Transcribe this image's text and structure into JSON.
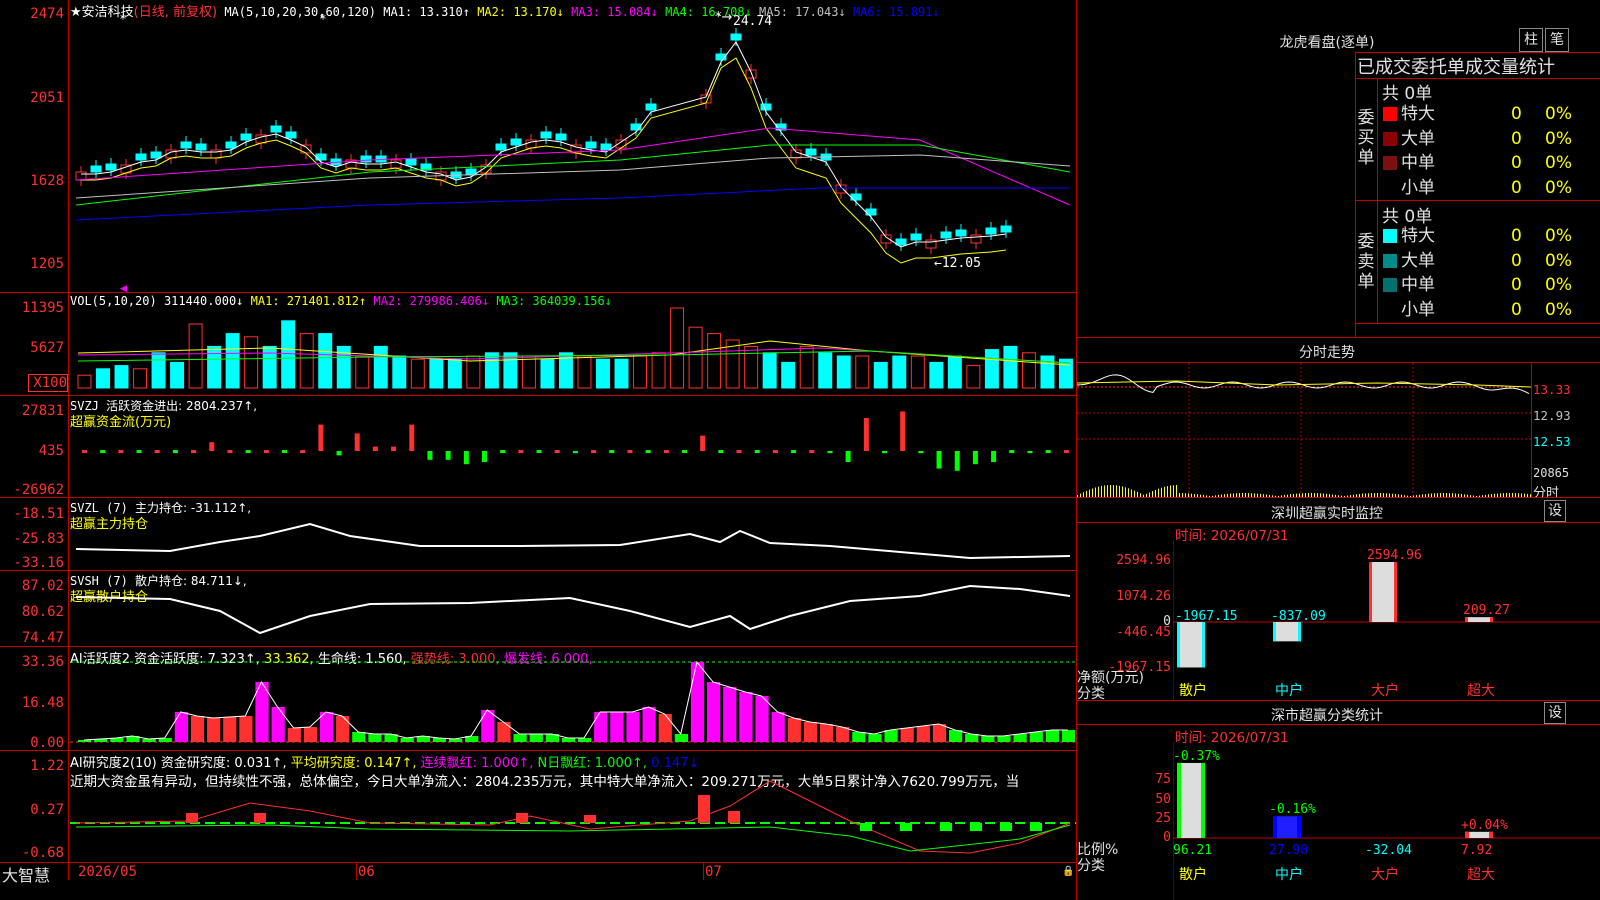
{
  "stock": {
    "name": "★安洁科技",
    "mode": "(日线, 前复权)",
    "ma_label": "MA(5,10,20,30,60,120)",
    "ma_values": [
      {
        "label": "MA1: 13.310↑",
        "color": "#ffffff"
      },
      {
        "label": "MA2: 13.170↓",
        "color": "#ffff00"
      },
      {
        "label": "MA3: 15.084↓",
        "color": "#ff00ff"
      },
      {
        "label": "MA4: 16.708↓",
        "color": "#00ff00"
      },
      {
        "label": "MA5: 17.043↓",
        "color": "#c0c0c0"
      },
      {
        "label": "MA6: 15.891↓",
        "color": "#0000ff"
      }
    ],
    "high_marker": "24.74",
    "low_marker": "←12.05",
    "price_ticks": [
      "2474",
      "2051",
      "1628",
      "1205"
    ],
    "star_marks": [
      "*",
      "*",
      "*"
    ]
  },
  "vol": {
    "title": "VOL(5,10,20)",
    "value": "311440.000↓",
    "ma1": "MA1: 271401.812↑",
    "ma2": "MA2: 279986.406↓",
    "ma3": "MA3: 364039.156↓",
    "ticks": [
      "11395",
      "5627",
      "X100"
    ],
    "bars": [
      4,
      6,
      7,
      6,
      11,
      8,
      20,
      13,
      17,
      16,
      13,
      21,
      17,
      17,
      13,
      10,
      13,
      10,
      9,
      9,
      9,
      10,
      11,
      11,
      10,
      9,
      11,
      10,
      9,
      9,
      10,
      11,
      25,
      19,
      17,
      15,
      13,
      11,
      8,
      13,
      11,
      10,
      10,
      8,
      10,
      10,
      8,
      10,
      7,
      12,
      13,
      11,
      10,
      9
    ]
  },
  "svzj": {
    "title": "SVZJ",
    "label": "活跃资金进出: 2804.237↑,",
    "sub": "超赢资金流(万元)",
    "ticks": [
      "27831",
      "435",
      "-26962"
    ],
    "values": [
      0,
      0,
      0,
      0,
      0,
      0,
      0,
      4,
      0,
      0,
      0,
      0,
      0,
      12,
      -2,
      8,
      2,
      2,
      12,
      -4,
      -4,
      -6,
      -5,
      0,
      0,
      0,
      0,
      -1,
      0,
      0,
      0,
      0,
      0,
      0,
      7,
      0,
      0,
      0,
      0,
      0,
      0,
      -1,
      -5,
      15,
      -1,
      18,
      -1,
      -8,
      -9,
      -6,
      -5,
      0,
      -1,
      0,
      0
    ]
  },
  "svzl": {
    "title": "SVZL (7)",
    "label": "主力持仓: -31.112↑,",
    "sub": "超赢主力持仓",
    "ticks": [
      "-18.51",
      "-25.83",
      "-33.16"
    ]
  },
  "svsh": {
    "title": "SVSH (7)",
    "label": "散户持仓: 84.711↓,",
    "sub": "超赢散户持仓",
    "ticks": [
      "87.02",
      "80.62",
      "74.47"
    ]
  },
  "ai1": {
    "title": "AI活跃度2",
    "label": "资金活跃度: 7.323↑,",
    "v2": "33.362,",
    "life": "生命线: 1.560,",
    "strong": "强势线: 3.000,",
    "burst": "爆发线: 6.000,",
    "ticks": [
      "33.36",
      "16.48",
      "0.00"
    ]
  },
  "ai2": {
    "title": "AI研究度2(10)",
    "label": "资金研究度: 0.031↑,",
    "avg": "平均研究度: 0.147↑,",
    "cont": "连续飘红: 1.000↑,",
    "nday": "N日飘红: 1.000↑,",
    "last": "0.147↓",
    "comment": "近期大资金虽有异动，但持续性不强，总体偏空，今日大单净流入：2804.235万元，其中特大单净流入：209.271万元，大单5日累计净入7620.799万元，当",
    "ticks": [
      "1.22",
      "0.27",
      "-0.68"
    ]
  },
  "xaxis": {
    "brand": "大智慧",
    "labels": [
      "2026/05",
      "06",
      "07"
    ]
  },
  "dragon": {
    "title": "龙虎看盘(逐单)",
    "btn_bar": "柱",
    "btn_pen": "笔",
    "tabs": "已成交委托单成交量统计",
    "buy_label": "委买单",
    "sell_label": "委卖单",
    "buy_total": "共 0单",
    "sell_total": "共 0单",
    "buy_rows": [
      {
        "name": "特大",
        "count": "0",
        "pct": "0%",
        "color": "#ff0000"
      },
      {
        "name": "大单",
        "count": "0",
        "pct": "0%",
        "color": "#8b0000"
      },
      {
        "name": "中单",
        "count": "0",
        "pct": "0%",
        "color": "#7a1010"
      },
      {
        "name": "小单",
        "count": "0",
        "pct": "0%",
        "color": "#000000"
      }
    ],
    "sell_rows": [
      {
        "name": "特大",
        "count": "0",
        "pct": "0%",
        "color": "#00ffff"
      },
      {
        "name": "大单",
        "count": "0",
        "pct": "0%",
        "color": "#008b8b"
      },
      {
        "name": "中单",
        "count": "0",
        "pct": "0%",
        "color": "#007070"
      },
      {
        "name": "小单",
        "count": "0",
        "pct": "0%",
        "color": "#000000"
      }
    ]
  },
  "intraday": {
    "title": "分时走势",
    "ticks": [
      "13.33",
      "12.93",
      "12.53",
      "20865"
    ],
    "unit": "分时"
  },
  "sz_monitor": {
    "title": "深圳超赢实时监控",
    "btn": "设",
    "time": "时间: 2026/07/31",
    "yticks": [
      "2594.96",
      "1074.26",
      "0",
      "-446.45",
      "-1967.15"
    ],
    "ylabel": "净额(万元)",
    "xlabel": "分类",
    "categories": [
      "散户",
      "中户",
      "大户",
      "超大"
    ],
    "values": [
      -1967.15,
      -837.09,
      2594.96,
      209.27
    ],
    "value_labels": [
      "-1967.15",
      "-837.09",
      "2594.96",
      "209.27"
    ]
  },
  "sz_class": {
    "title": "深市超赢分类统计",
    "btn": "设",
    "time": "时间: 2026/07/31",
    "yticks": [
      "75",
      "50",
      "25",
      "0"
    ],
    "ylabel": "比例%",
    "xlabel": "分类",
    "categories": [
      "散户",
      "中户",
      "大户",
      "超大"
    ],
    "top_labels": [
      "-0.37%",
      "-0.16%",
      "",
      "+0.04%"
    ],
    "bottom_labels": [
      "96.21",
      "27.90",
      "-32.04",
      "7.92"
    ],
    "heights": [
      96.21,
      27.9,
      0,
      7.92
    ]
  }
}
